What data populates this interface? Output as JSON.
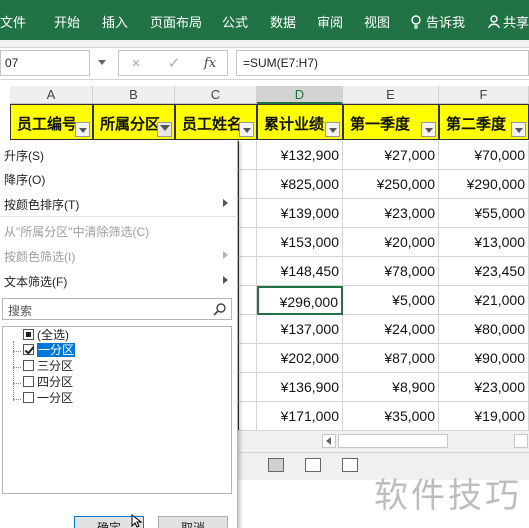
{
  "ribbon": {
    "tabs": [
      "文件",
      "开始",
      "插入",
      "页面布局",
      "公式",
      "数据",
      "审阅",
      "视图"
    ],
    "tell_me": "告诉我",
    "share": "共享",
    "color": "#217346"
  },
  "formula_bar": {
    "name_box": "07",
    "cancel_glyph": "×",
    "enter_glyph": "✓",
    "fx_label": "fx",
    "formula": "=SUM(E7:H7)"
  },
  "columns": [
    "A",
    "B",
    "C",
    "D",
    "E",
    "F"
  ],
  "header_row": [
    "员工编号",
    "所属分区",
    "员工姓名",
    "累计业绩",
    "第一季度",
    "第二季度"
  ],
  "rows": [
    {
      "D": "¥132,900",
      "E": "¥27,000",
      "F": "¥70,000"
    },
    {
      "D": "¥825,000",
      "E": "¥250,000",
      "F": "¥290,000"
    },
    {
      "D": "¥139,000",
      "E": "¥23,000",
      "F": "¥55,000"
    },
    {
      "D": "¥153,000",
      "E": "¥20,000",
      "F": "¥13,000"
    },
    {
      "D": "¥148,450",
      "E": "¥78,000",
      "F": "¥23,450"
    },
    {
      "D": "¥296,000",
      "E": "¥5,000",
      "F": "¥21,000"
    },
    {
      "D": "¥137,000",
      "E": "¥24,000",
      "F": "¥80,000"
    },
    {
      "D": "¥202,000",
      "E": "¥87,000",
      "F": "¥90,000"
    },
    {
      "D": "¥136,900",
      "E": "¥8,900",
      "F": "¥23,000"
    },
    {
      "D": "¥171,000",
      "E": "¥35,000",
      "F": "¥19,000"
    }
  ],
  "filter_menu": {
    "sort_asc": "升序(S)",
    "sort_desc": "降序(O)",
    "sort_by_color": "按颜色排序(T)",
    "clear_filter": "从\"所属分区\"中清除筛选(C)",
    "filter_by_color": "按颜色筛选(I)",
    "text_filters": "文本筛选(F)",
    "search_placeholder": "搜索",
    "items": [
      {
        "label": "(全选)",
        "state": "mixed"
      },
      {
        "label": "一分区",
        "state": "checked"
      },
      {
        "label": "三分区",
        "state": "unchecked"
      },
      {
        "label": "四分区",
        "state": "unchecked"
      },
      {
        "label": "一分区",
        "state": "unchecked"
      }
    ],
    "ok": "确定",
    "cancel": "取消"
  },
  "watermark": "软件技巧"
}
